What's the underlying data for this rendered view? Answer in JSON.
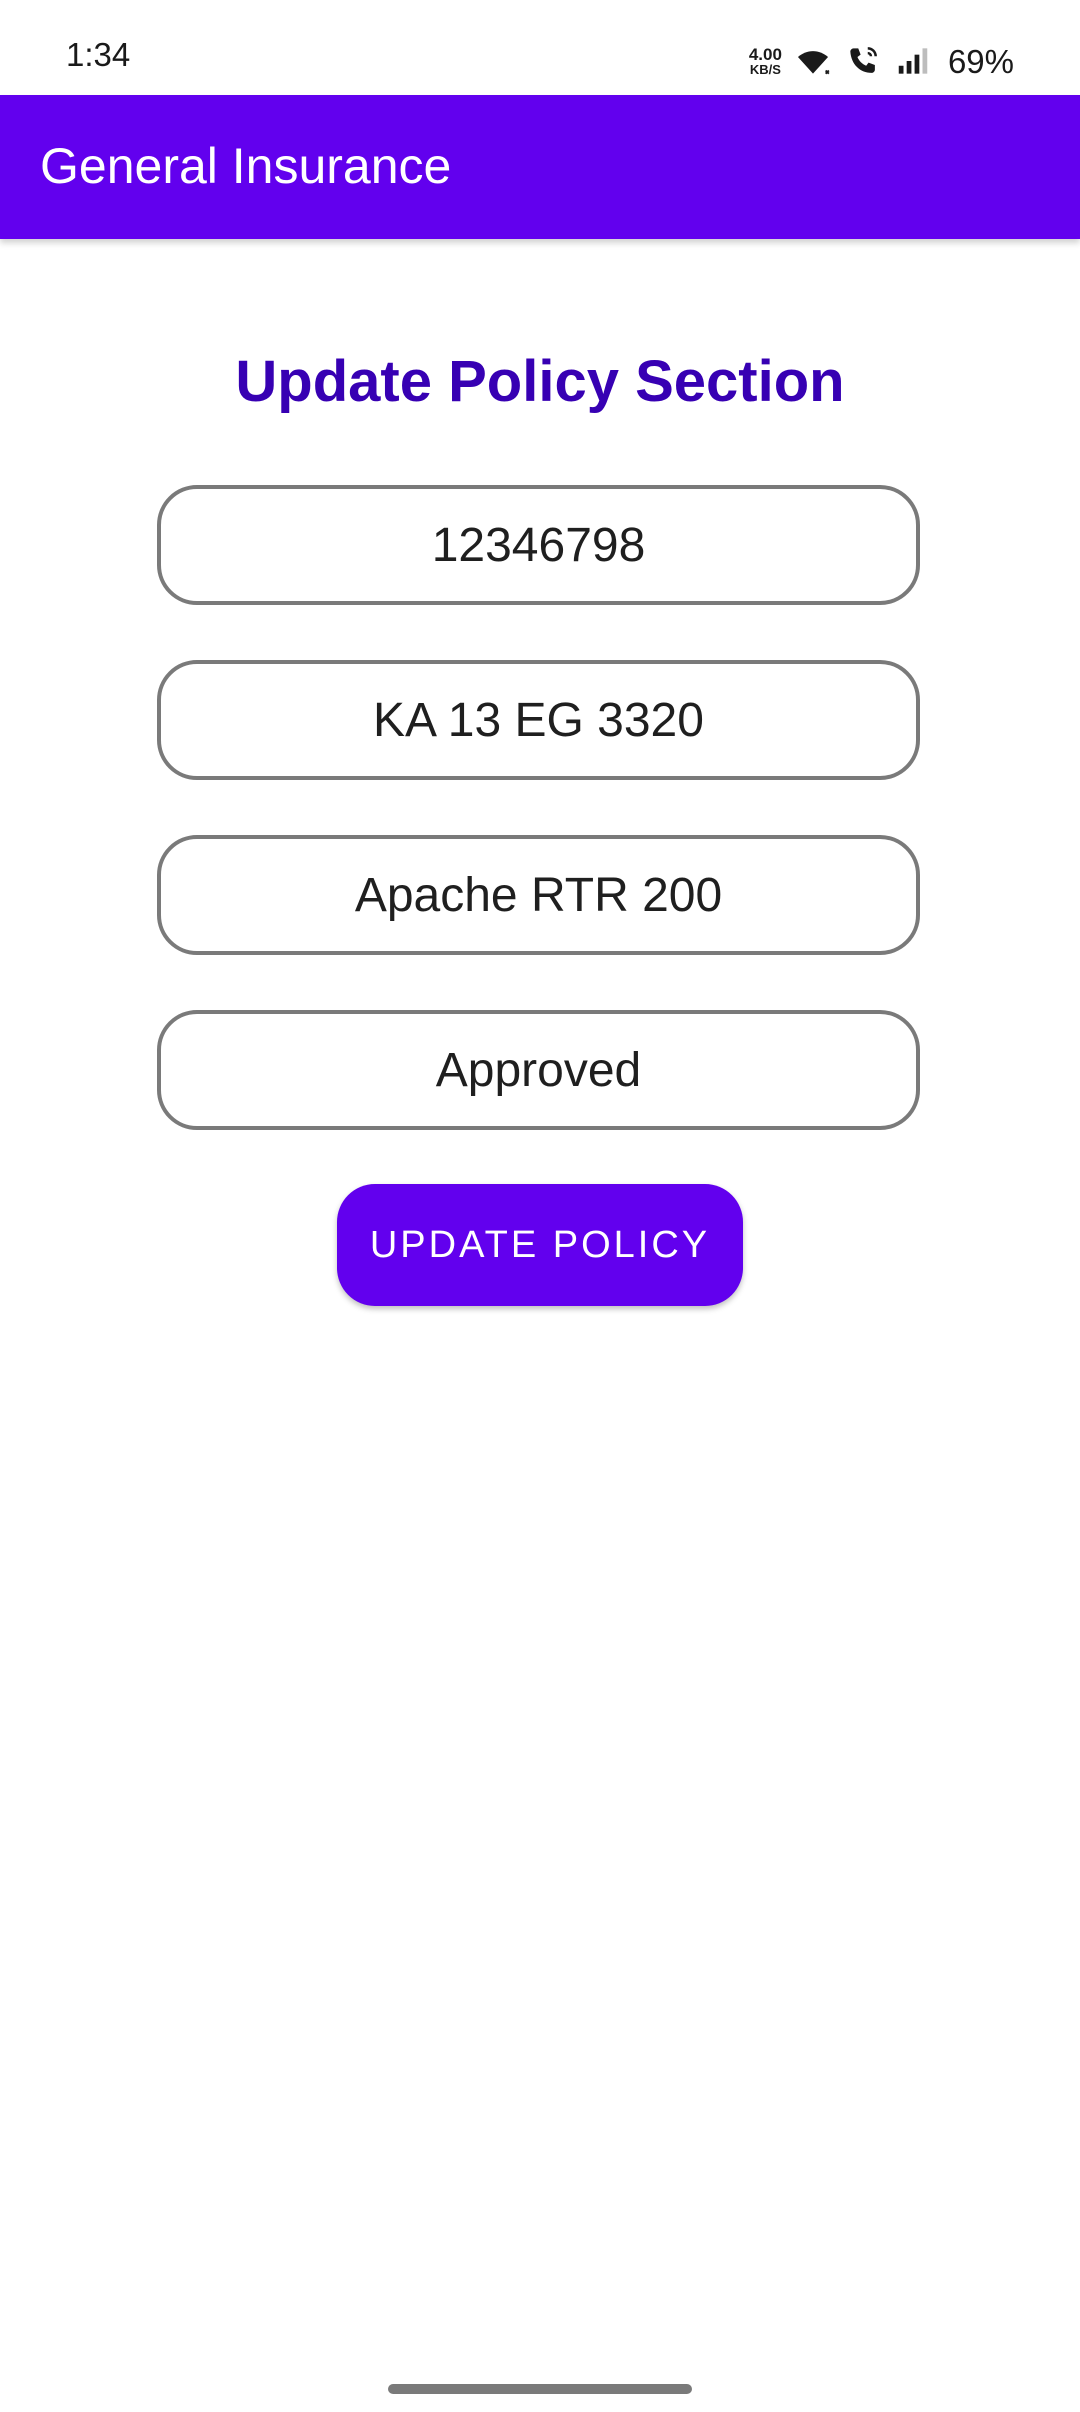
{
  "status_bar": {
    "time": "1:34",
    "net_speed_value": "4.00",
    "net_speed_unit": "KB/S",
    "battery": "69%",
    "icons": [
      "wifi-icon",
      "wifi-calling-icon",
      "signal-icon"
    ]
  },
  "app_bar": {
    "title": "General Insurance",
    "color": "#6200EE"
  },
  "main": {
    "section_title": "Update Policy Section",
    "section_title_color": "#3700B3",
    "fields": {
      "policy_number": "12346798",
      "vehicle_number": "KA 13 EG 3320",
      "vehicle_model": "Apache RTR 200",
      "status": "Approved"
    },
    "update_button_label": "UPDATE POLICY"
  }
}
